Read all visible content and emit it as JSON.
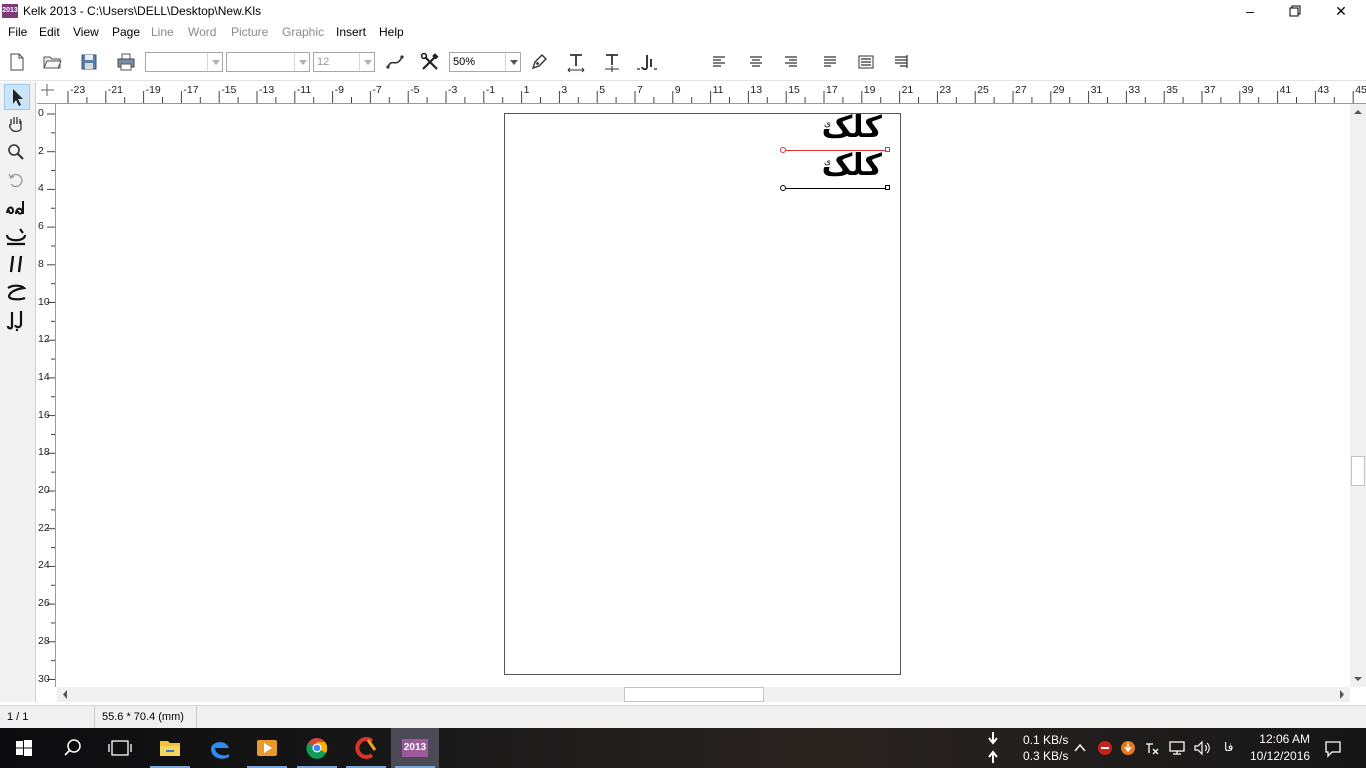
{
  "window": {
    "icon_text": "2013",
    "title": "Kelk 2013 - C:\\Users\\DELL\\Desktop\\New.Kls",
    "minimize_glyph": "–",
    "maximize_glyph": "❐",
    "close_glyph": "✕"
  },
  "menu": {
    "items": [
      {
        "label": "File",
        "enabled": true
      },
      {
        "label": "Edit",
        "enabled": true
      },
      {
        "label": "View",
        "enabled": true
      },
      {
        "label": "Page",
        "enabled": true
      },
      {
        "label": "Line",
        "enabled": false
      },
      {
        "label": "Word",
        "enabled": false
      },
      {
        "label": "Picture",
        "enabled": false
      },
      {
        "label": "Graphic",
        "enabled": false
      },
      {
        "label": "Insert",
        "enabled": true
      },
      {
        "label": "Help",
        "enabled": true
      }
    ]
  },
  "toolbar": {
    "font_combo": "",
    "style_combo": "",
    "size_combo": "12",
    "zoom_combo": "50%",
    "icons": [
      "new-document-icon",
      "open-folder-icon",
      "save-icon",
      "print-icon",
      "curve-tool-icon",
      "tools-icon",
      "pen-icon",
      "text-size-icon",
      "text-move-icon",
      "word-spacing-icon",
      "align-left-icon",
      "align-center-icon",
      "align-right-icon",
      "justify-left-icon",
      "justify-full-icon",
      "justify-right-icon"
    ]
  },
  "rulers": {
    "horizontal": [
      "-23",
      "-21",
      "-19",
      "-17",
      "-15",
      "-13",
      "-11",
      "-9",
      "-7",
      "-5",
      "-3",
      "-1",
      "1",
      "3",
      "5",
      "7",
      "9",
      "11",
      "13",
      "15",
      "17",
      "19",
      "21",
      "23",
      "25",
      "27",
      "29",
      "31",
      "33",
      "35",
      "37",
      "39",
      "41",
      "43",
      "45"
    ],
    "vertical": [
      "0",
      "2",
      "4",
      "6",
      "8",
      "10",
      "12",
      "14",
      "16",
      "18",
      "20",
      "22",
      "24",
      "26",
      "28",
      "30"
    ]
  },
  "document": {
    "lines": [
      {
        "text": "کلک",
        "mark": "ی",
        "selected": true
      },
      {
        "text": "کلک",
        "mark": "ی",
        "selected": false
      }
    ]
  },
  "left_tools": [
    "pointer-icon",
    "hand-icon",
    "zoom-icon",
    "rotate-icon",
    "glyph-ha-icon",
    "glyph-swash-icon",
    "glyph-alef-icon",
    "glyph-jim-icon",
    "glyph-bal-icon"
  ],
  "status": {
    "page": "1 / 1",
    "size": "55.6 * 70.4 (mm)"
  },
  "colors": {
    "selection_line": "#d9342b",
    "accent": "#7aa7d8",
    "app_icon": "#7b3a7a"
  },
  "taskbar": {
    "apps": [
      "start-icon",
      "search-icon",
      "task-view-icon",
      "file-explorer-icon",
      "edge-icon",
      "media-player-icon",
      "chrome-icon",
      "ccleaner-icon",
      "kelk-icon"
    ],
    "kelk_label": "2013",
    "download_speed": "0.1 KB/s",
    "upload_speed": "0.3 KB/s",
    "language": "فا",
    "time": "12:06 AM",
    "date": "10/12/2016"
  }
}
